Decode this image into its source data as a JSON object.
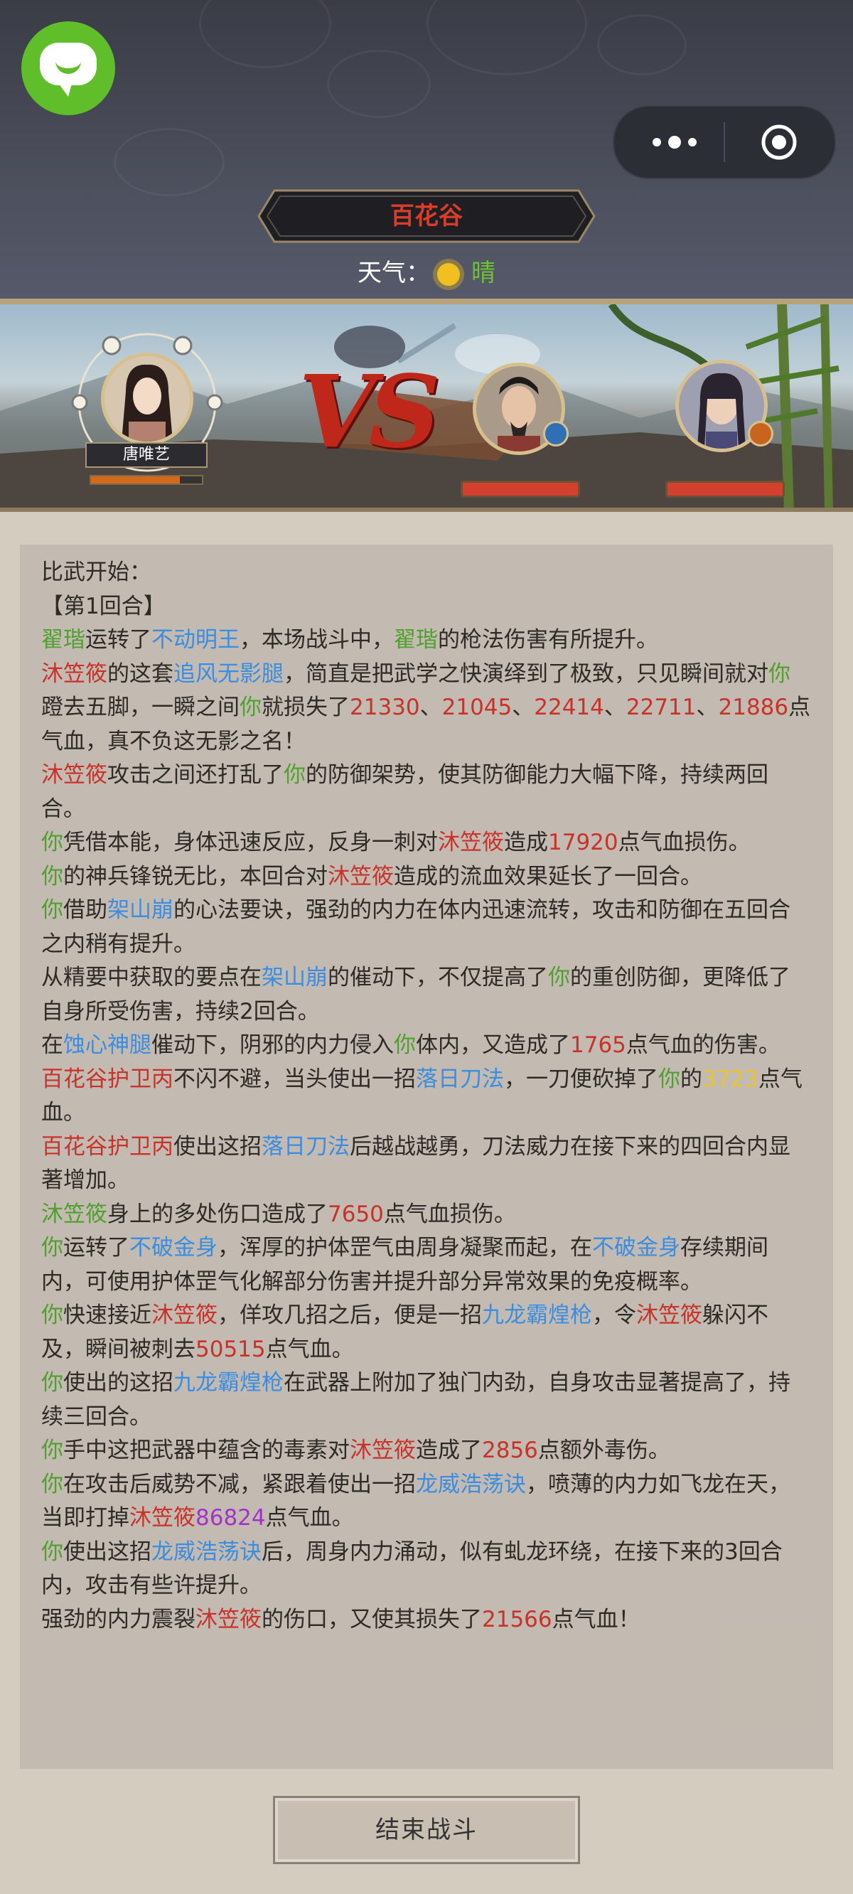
{
  "header": {
    "location": "百花谷",
    "weather_label": "天气：",
    "weather_value": "晴",
    "weather_icon": "sun-icon"
  },
  "battle": {
    "player_name": "唐唯艺",
    "player_hp": 0.8,
    "enemy1_hp": 1.0,
    "enemy2_hp": 1.0,
    "vs_label": "VS"
  },
  "log": {
    "lines": [
      [
        {
          "t": "比武开始："
        }
      ],
      [
        {
          "t": "【第1回合】"
        }
      ],
      [
        {
          "t": "翟瑎",
          "c": "g"
        },
        {
          "t": "运转了"
        },
        {
          "t": "不动明王",
          "c": "b"
        },
        {
          "t": "，本场战斗中，"
        },
        {
          "t": "翟瑎",
          "c": "g"
        },
        {
          "t": "的枪法伤害有所提升。"
        }
      ],
      [
        {
          "t": "沐笠筱",
          "c": "r"
        },
        {
          "t": "的这套"
        },
        {
          "t": "追风无影腿",
          "c": "b"
        },
        {
          "t": "，简直是把武学之快演绎到了极致，只见瞬间就对"
        },
        {
          "t": "你",
          "c": "g"
        },
        {
          "t": "蹬去五脚，一瞬之间"
        },
        {
          "t": "你",
          "c": "g"
        },
        {
          "t": "就损失了"
        },
        {
          "t": "21330",
          "c": "r"
        },
        {
          "t": "、"
        },
        {
          "t": "21045",
          "c": "r"
        },
        {
          "t": "、"
        },
        {
          "t": "22414",
          "c": "r"
        },
        {
          "t": "、"
        },
        {
          "t": "22711",
          "c": "r"
        },
        {
          "t": "、"
        },
        {
          "t": "21886",
          "c": "r"
        },
        {
          "t": "点气血，真不负这无影之名！"
        }
      ],
      [
        {
          "t": "沐笠筱",
          "c": "r"
        },
        {
          "t": "攻击之间还打乱了"
        },
        {
          "t": "你",
          "c": "g"
        },
        {
          "t": "的防御架势，使其防御能力大幅下降，持续两回合。"
        }
      ],
      [
        {
          "t": "你",
          "c": "g"
        },
        {
          "t": "凭借本能，身体迅速反应，反身一刺对"
        },
        {
          "t": "沐笠筱",
          "c": "r"
        },
        {
          "t": "造成"
        },
        {
          "t": "17920",
          "c": "r"
        },
        {
          "t": "点气血损伤。"
        }
      ],
      [
        {
          "t": "你",
          "c": "g"
        },
        {
          "t": "的神兵锋锐无比，本回合对"
        },
        {
          "t": "沐笠筱",
          "c": "r"
        },
        {
          "t": "造成的流血效果延长了一回合。"
        }
      ],
      [
        {
          "t": "你",
          "c": "g"
        },
        {
          "t": "借助"
        },
        {
          "t": "架山崩",
          "c": "b"
        },
        {
          "t": "的心法要诀，强劲的内力在体内迅速流转，攻击和防御在五回合之内稍有提升。"
        }
      ],
      [
        {
          "t": "从精要中获取的要点在"
        },
        {
          "t": "架山崩",
          "c": "b"
        },
        {
          "t": "的催动下，不仅提高了"
        },
        {
          "t": "你",
          "c": "g"
        },
        {
          "t": "的重创防御，更降低了自身所受伤害，持续2回合。"
        }
      ],
      [
        {
          "t": "在"
        },
        {
          "t": "蚀心神腿",
          "c": "b"
        },
        {
          "t": "催动下，阴邪的内力侵入"
        },
        {
          "t": "你",
          "c": "g"
        },
        {
          "t": "体内，又造成了"
        },
        {
          "t": "1765",
          "c": "r"
        },
        {
          "t": "点气血的伤害。"
        }
      ],
      [
        {
          "t": "百花谷护卫丙",
          "c": "r"
        },
        {
          "t": "不闪不避，当头使出一招"
        },
        {
          "t": "落日刀法",
          "c": "b"
        },
        {
          "t": "，一刀便砍掉了"
        },
        {
          "t": "你",
          "c": "g"
        },
        {
          "t": "的"
        },
        {
          "t": "3723",
          "c": "y"
        },
        {
          "t": "点气血。"
        }
      ],
      [
        {
          "t": "百花谷护卫丙",
          "c": "r"
        },
        {
          "t": "使出这招"
        },
        {
          "t": "落日刀法",
          "c": "b"
        },
        {
          "t": "后越战越勇，刀法威力在接下来的四回合内显著增加。"
        }
      ],
      [
        {
          "t": "沐笠筱",
          "c": "g"
        },
        {
          "t": "身上的多处伤口造成了"
        },
        {
          "t": "7650",
          "c": "r"
        },
        {
          "t": "点气血损伤。"
        }
      ],
      [
        {
          "t": "你",
          "c": "g"
        },
        {
          "t": "运转了"
        },
        {
          "t": "不破金身",
          "c": "b"
        },
        {
          "t": "，浑厚的护体罡气由周身凝聚而起，在"
        },
        {
          "t": "不破金身",
          "c": "b"
        },
        {
          "t": "存续期间内，可使用护体罡气化解部分伤害并提升部分异常效果的免疫概率。"
        }
      ],
      [
        {
          "t": "你",
          "c": "g"
        },
        {
          "t": "快速接近"
        },
        {
          "t": "沐笠筱",
          "c": "r"
        },
        {
          "t": "，佯攻几招之后，便是一招"
        },
        {
          "t": "九龙霸煌枪",
          "c": "b"
        },
        {
          "t": "，令"
        },
        {
          "t": "沐笠筱",
          "c": "r"
        },
        {
          "t": "躲闪不及，瞬间被刺去"
        },
        {
          "t": "50515",
          "c": "r"
        },
        {
          "t": "点气血。"
        }
      ],
      [
        {
          "t": "你",
          "c": "g"
        },
        {
          "t": "使出的这招"
        },
        {
          "t": "九龙霸煌枪",
          "c": "b"
        },
        {
          "t": "在武器上附加了独门内劲，自身攻击显著提高了，持续三回合。"
        }
      ],
      [
        {
          "t": "你",
          "c": "g"
        },
        {
          "t": "手中这把武器中蕴含的毒素对"
        },
        {
          "t": "沐笠筱",
          "c": "r"
        },
        {
          "t": "造成了"
        },
        {
          "t": "2856",
          "c": "r"
        },
        {
          "t": "点额外毒伤。"
        }
      ],
      [
        {
          "t": "你",
          "c": "g"
        },
        {
          "t": "在攻击后威势不减，紧跟着使出一招"
        },
        {
          "t": "龙威浩荡诀",
          "c": "b"
        },
        {
          "t": "，喷薄的内力如飞龙在天，当即打掉"
        },
        {
          "t": "沐笠筱",
          "c": "r"
        },
        {
          "t": "86824",
          "c": "p"
        },
        {
          "t": "点气血。"
        }
      ],
      [
        {
          "t": "你",
          "c": "g"
        },
        {
          "t": "使出这招"
        },
        {
          "t": "龙威浩荡诀",
          "c": "b"
        },
        {
          "t": "后，周身内力涌动，似有虬龙环绕，在接下来的3回合内，攻击有些许提升。"
        }
      ],
      [
        {
          "t": "强劲的内力震裂"
        },
        {
          "t": "沐笠筱",
          "c": "r"
        },
        {
          "t": "的伤口，又使其损失了"
        },
        {
          "t": "21566",
          "c": "r"
        },
        {
          "t": "点气血！"
        }
      ]
    ]
  },
  "footer": {
    "end_button": "结束战斗"
  }
}
